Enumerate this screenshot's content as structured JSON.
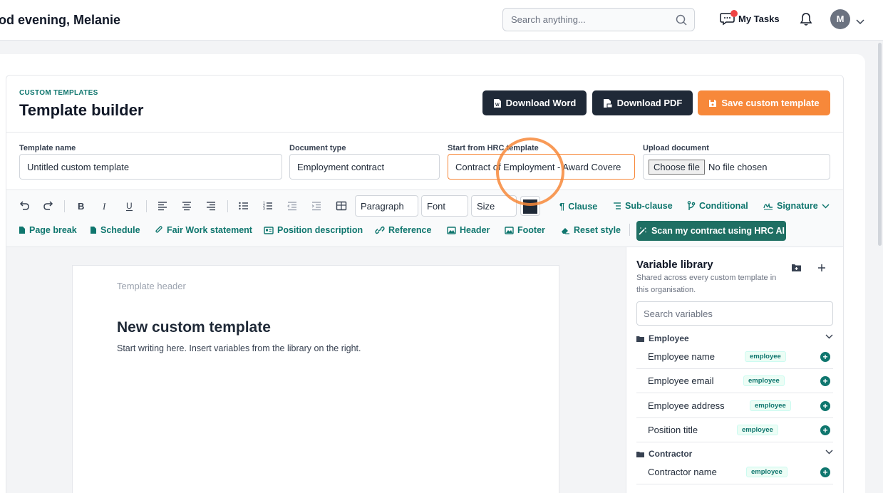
{
  "header": {
    "greeting": "od evening, Melanie",
    "search_placeholder": "Search anything...",
    "tasks_label": "My Tasks",
    "avatar_initial": "M"
  },
  "page": {
    "eyebrow": "CUSTOM TEMPLATES",
    "title": "Template builder",
    "actions": {
      "download_word": "Download Word",
      "download_pdf": "Download PDF",
      "save": "Save custom template"
    }
  },
  "fields": {
    "template_name": {
      "label": "Template name",
      "value": "Untitled custom template"
    },
    "document_type": {
      "label": "Document type",
      "value": "Employment contract"
    },
    "start_from": {
      "label": "Start from HRC template",
      "value": "Contract of Employment - Award Covere"
    },
    "upload": {
      "label": "Upload document",
      "button": "Choose file",
      "status": "No file chosen"
    }
  },
  "toolbar": {
    "paragraph": "Paragraph",
    "font": "Font",
    "size": "Size",
    "text_color": "#1f2937",
    "row1_links": [
      "Clause",
      "Sub-clause",
      "Conditional",
      "Signature"
    ],
    "row2_links": [
      "Page break",
      "Schedule",
      "Fair Work statement",
      "Position description",
      "Reference",
      "Header",
      "Footer",
      "Reset style"
    ],
    "scan_button": "Scan my contract using HRC AI"
  },
  "editor": {
    "template_header": "Template header",
    "doc_title": "New custom template",
    "doc_body": "Start writing here. Insert variables from the library on the right."
  },
  "library": {
    "title": "Variable library",
    "subtitle": "Shared across every custom template in this organisation.",
    "search_placeholder": "Search variables",
    "groups": [
      {
        "name": "Employee",
        "items": [
          {
            "name": "Employee name",
            "tag": "employee"
          },
          {
            "name": "Employee email",
            "tag": "employee"
          },
          {
            "name": "Employee address",
            "tag": "employee"
          },
          {
            "name": "Position title",
            "tag": "employee"
          }
        ]
      },
      {
        "name": "Contractor",
        "items": [
          {
            "name": "Contractor name",
            "tag": "employee"
          }
        ]
      }
    ]
  },
  "colors": {
    "accent": "#0f766e",
    "primary_dark": "#1f2937",
    "orange": "#f7883a",
    "scan_button": "#1f6f63"
  }
}
